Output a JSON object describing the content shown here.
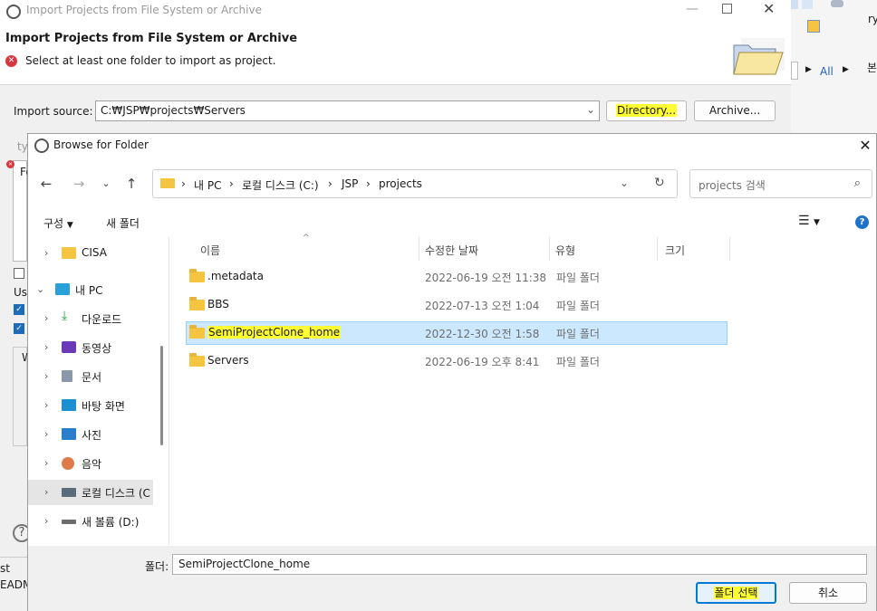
{
  "eclipse": {
    "window_title": "Import Projects from File System or Archive",
    "heading": "Import Projects from File System or Archive",
    "error_message": "Select at least one folder to import as project.",
    "import_source_label": "Import source:",
    "import_source_value": "C:₩JSP₩projects₩Servers",
    "directory_button": "Directory...",
    "archive_button": "Archive...",
    "partial_left_texts": [
      "ty",
      "Fo",
      "Use",
      "W"
    ],
    "bottom_left_texts": [
      "st",
      "EADM"
    ]
  },
  "bg_app": {
    "link_all": "All",
    "partial_right": "본",
    "partial_top": "ry"
  },
  "browse": {
    "title": "Browse for Folder",
    "breadcrumb": [
      "내 PC",
      "로컬 디스크 (C:)",
      "JSP",
      "projects"
    ],
    "search_placeholder": "projects 검색",
    "organize": "구성",
    "new_folder": "새 폴더",
    "columns": [
      "이름",
      "수정한 날짜",
      "유형",
      "크기"
    ],
    "nav_items": [
      {
        "label": "CISA",
        "icon": "folder-icon"
      },
      {
        "label": "내 PC",
        "icon": "pc-icon"
      },
      {
        "label": "다운로드",
        "icon": "download-icon"
      },
      {
        "label": "동영상",
        "icon": "video-icon"
      },
      {
        "label": "문서",
        "icon": "document-icon"
      },
      {
        "label": "바탕 화면",
        "icon": "desktop-icon"
      },
      {
        "label": "사진",
        "icon": "pictures-icon"
      },
      {
        "label": "음악",
        "icon": "music-icon"
      },
      {
        "label": "로컬 디스크 (C",
        "icon": "disk-icon"
      },
      {
        "label": "새 볼륨 (D:)",
        "icon": "drive-icon"
      }
    ],
    "files": [
      {
        "name": ".metadata",
        "date": "2022-06-19 오전 11:38",
        "type": "파일 폴더"
      },
      {
        "name": "BBS",
        "date": "2022-07-13 오전 1:04",
        "type": "파일 폴더"
      },
      {
        "name": "SemiProjectClone_home",
        "date": "2022-12-30 오전 1:58",
        "type": "파일 폴더"
      },
      {
        "name": "Servers",
        "date": "2022-06-19 오후 8:41",
        "type": "파일 폴더"
      }
    ],
    "folder_label": "폴더:",
    "folder_value": "SemiProjectClone_home",
    "select_button": "폴더 선택",
    "cancel_button": "취소"
  },
  "colors": {
    "selection": "#cce8ff",
    "highlight": "#ffff33",
    "accent": "#0078d7"
  }
}
